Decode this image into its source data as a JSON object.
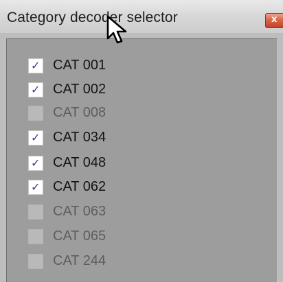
{
  "window": {
    "title": "Category decoder selector",
    "close_glyph": "x"
  },
  "icons": {
    "close": "close-icon",
    "cursor": "mouse-pointer-icon",
    "check": "checkmark-icon"
  },
  "colors": {
    "panel_background": "#9d9d9d",
    "checkmark": "#2c3f8c",
    "close_button": "#d9664a"
  },
  "categories": [
    {
      "label": "CAT 001",
      "checked": true
    },
    {
      "label": "CAT 002",
      "checked": true
    },
    {
      "label": "CAT 008",
      "checked": false
    },
    {
      "label": "CAT 034",
      "checked": true
    },
    {
      "label": "CAT 048",
      "checked": true
    },
    {
      "label": "CAT 062",
      "checked": true
    },
    {
      "label": "CAT 063",
      "checked": false
    },
    {
      "label": "CAT 065",
      "checked": false
    },
    {
      "label": "CAT 244",
      "checked": false
    }
  ]
}
